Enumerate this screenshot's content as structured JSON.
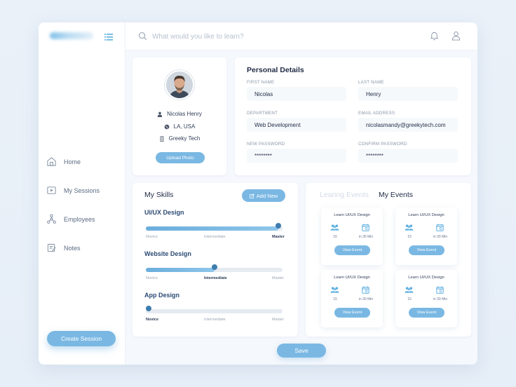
{
  "search": {
    "placeholder": "What would you like to learn?"
  },
  "sidebar": {
    "items": [
      {
        "label": "Home",
        "icon": "home-icon"
      },
      {
        "label": "My Sessions",
        "icon": "video-icon"
      },
      {
        "label": "Employees",
        "icon": "org-chart-icon"
      },
      {
        "label": "Notes",
        "icon": "notes-icon"
      }
    ],
    "create_label": "Create Session"
  },
  "profile": {
    "name": "Nicolas Henry",
    "location": "LA, USA",
    "company": "Greeky Tech",
    "upload_label": "Upload Photo"
  },
  "details": {
    "title": "Personal Details",
    "first_name": {
      "label": "FIRST NAME",
      "value": "Nicolas"
    },
    "last_name": {
      "label": "LAST NAME",
      "value": "Henry"
    },
    "department": {
      "label": "DEPARTMENT",
      "value": "Web Development"
    },
    "email": {
      "label": "EMAIL ADDRESS",
      "value": "nicolasmandy@greekytech.com"
    },
    "new_password": {
      "label": "NEW PASSWORD",
      "value": "********"
    },
    "confirm_password": {
      "label": "CONFIRM PASSWORD",
      "value": "********"
    }
  },
  "skills": {
    "title": "My Skills",
    "add_label": "Add New",
    "levels": [
      "Novice",
      "Intermediate",
      "Master"
    ],
    "items": [
      {
        "name": "UI/UX Design",
        "progress": 0.97,
        "level": "Master"
      },
      {
        "name": "Website Design",
        "progress": 0.5,
        "level": "Intermediate"
      },
      {
        "name": "App Design",
        "progress": 0.0,
        "level": "Novice"
      }
    ]
  },
  "events": {
    "tabs": [
      "Learing Events",
      "My Events"
    ],
    "active_tab": "My Events",
    "items": [
      {
        "title": "Learn UI/UX Design",
        "attendees": "15",
        "time": "in 30 Min",
        "button": "View Event"
      },
      {
        "title": "Learn UI/UX Design",
        "attendees": "15",
        "time": "in 30 Min",
        "button": "View Event"
      },
      {
        "title": "Learn UI/UX Design",
        "attendees": "15",
        "time": "in 30 Min",
        "button": "View Event"
      },
      {
        "title": "Learn UI/UX Design",
        "attendees": "15",
        "time": "in 30 Min",
        "button": "View Event"
      }
    ]
  },
  "save_label": "Save",
  "colors": {
    "accent": "#7ab8e3",
    "dark_accent": "#3d7cae",
    "background": "#eaf1f9"
  }
}
